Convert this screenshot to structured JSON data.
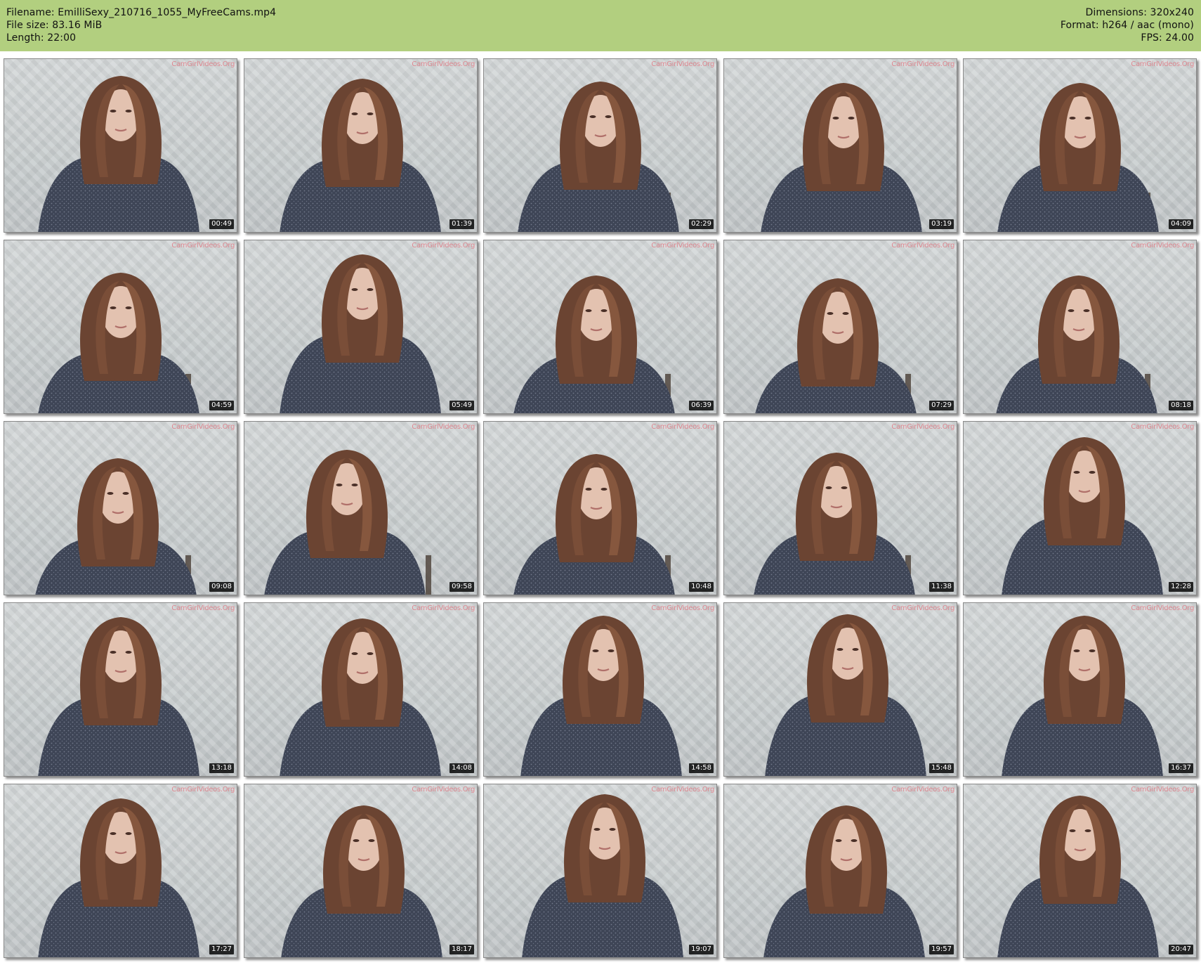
{
  "header": {
    "filename": "Filename: EmilliSexy_210716_1055_MyFreeCams.mp4",
    "filesize": "File size: 83.16 MiB",
    "length": "Length: 22:00",
    "dimensions": "Dimensions: 320x240",
    "format": "Format: h264 / aac (mono)",
    "fps": "FPS: 24.00",
    "background_color": "#b2cf7f"
  },
  "watermark": "CamGirlVideos.Org",
  "thumbnails": [
    {
      "time": "00:49"
    },
    {
      "time": "01:39"
    },
    {
      "time": "02:29"
    },
    {
      "time": "03:19"
    },
    {
      "time": "04:09"
    },
    {
      "time": "04:59"
    },
    {
      "time": "05:49"
    },
    {
      "time": "06:39"
    },
    {
      "time": "07:29"
    },
    {
      "time": "08:18"
    },
    {
      "time": "09:08"
    },
    {
      "time": "09:58"
    },
    {
      "time": "10:48"
    },
    {
      "time": "11:38"
    },
    {
      "time": "12:28"
    },
    {
      "time": "13:18"
    },
    {
      "time": "14:08"
    },
    {
      "time": "14:58"
    },
    {
      "time": "15:48"
    },
    {
      "time": "16:37"
    },
    {
      "time": "17:27"
    },
    {
      "time": "18:17"
    },
    {
      "time": "19:07"
    },
    {
      "time": "19:57"
    },
    {
      "time": "20:47"
    }
  ]
}
